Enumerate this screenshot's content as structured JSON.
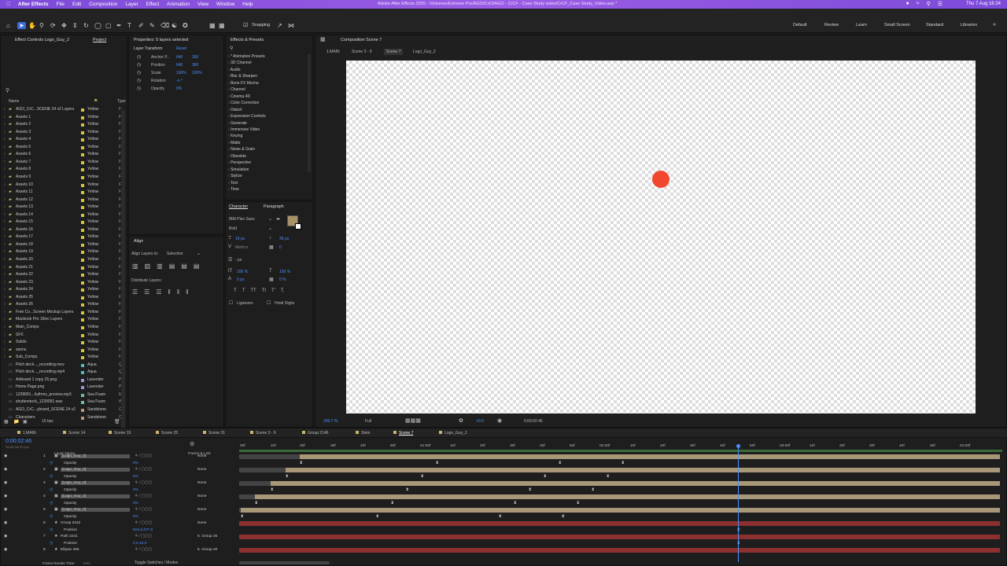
{
  "menubar": {
    "app": "After Effects",
    "items": [
      "File",
      "Edit",
      "Composition",
      "Layer",
      "Effect",
      "Animation",
      "View",
      "Window",
      "Help"
    ],
    "title": "Adobe After Effects 2025 - /Volumes/Extreme Pro/AGO/CrCf/AGO - CrCF - Case Study video/CrCF_Case Study_Video.aep *",
    "clock": "Thu 7 Aug  16:24"
  },
  "toolbar": {
    "snapping": "Snapping",
    "workspaces": [
      "Default",
      "Review",
      "Learn",
      "Small Screen",
      "Standard",
      "Libraries"
    ]
  },
  "effect_controls": {
    "tab": "Effect Controls Logo_Guy_2",
    "project_tab": "Project"
  },
  "properties": {
    "title": "Properties: 5 layers selected",
    "section": "Layer Transform",
    "reset": "Reset",
    "rows": [
      {
        "label": "Anchor P...",
        "v1": "640",
        "v2": "360"
      },
      {
        "label": "Position",
        "v1": "640",
        "v2": "360"
      },
      {
        "label": "Scale",
        "v1": "100%",
        "v2": "100%"
      },
      {
        "label": "Rotation",
        "v1": "-x-°",
        "v2": ""
      },
      {
        "label": "Opacity",
        "v1": "0%",
        "v2": ""
      }
    ]
  },
  "project": {
    "headers": [
      "Name",
      "Type"
    ],
    "items": [
      {
        "name": "AGO_CrC...SCENE 24 v2 Layers",
        "label": "Yellow",
        "type": "F",
        "folder": true
      },
      {
        "name": "Assets 1",
        "label": "Yellow",
        "type": "F",
        "folder": true
      },
      {
        "name": "Assets 2",
        "label": "Yellow",
        "type": "F",
        "folder": true
      },
      {
        "name": "Assets 3",
        "label": "Yellow",
        "type": "F",
        "folder": true
      },
      {
        "name": "Assets 4",
        "label": "Yellow",
        "type": "F",
        "folder": true
      },
      {
        "name": "Assets 5",
        "label": "Yellow",
        "type": "F",
        "folder": true
      },
      {
        "name": "Assets 6",
        "label": "Yellow",
        "type": "F",
        "folder": true
      },
      {
        "name": "Assets 7",
        "label": "Yellow",
        "type": "F",
        "folder": true
      },
      {
        "name": "Assets 8",
        "label": "Yellow",
        "type": "F",
        "folder": true
      },
      {
        "name": "Assets 9",
        "label": "Yellow",
        "type": "F",
        "folder": true
      },
      {
        "name": "Assets 10",
        "label": "Yellow",
        "type": "F",
        "folder": true
      },
      {
        "name": "Assets 11",
        "label": "Yellow",
        "type": "F",
        "folder": true
      },
      {
        "name": "Assets 12",
        "label": "Yellow",
        "type": "F",
        "folder": true
      },
      {
        "name": "Assets 13",
        "label": "Yellow",
        "type": "F",
        "folder": true
      },
      {
        "name": "Assets 14",
        "label": "Yellow",
        "type": "F",
        "folder": true
      },
      {
        "name": "Assets 15",
        "label": "Yellow",
        "type": "F",
        "folder": true
      },
      {
        "name": "Assets 16",
        "label": "Yellow",
        "type": "F",
        "folder": true
      },
      {
        "name": "Assets 17",
        "label": "Yellow",
        "type": "F",
        "folder": true
      },
      {
        "name": "Assets 18",
        "label": "Yellow",
        "type": "F",
        "folder": true
      },
      {
        "name": "Assets 19",
        "label": "Yellow",
        "type": "F",
        "folder": true
      },
      {
        "name": "Assets 20",
        "label": "Yellow",
        "type": "F",
        "folder": true
      },
      {
        "name": "Assets 21",
        "label": "Yellow",
        "type": "F",
        "folder": true
      },
      {
        "name": "Assets 22",
        "label": "Yellow",
        "type": "F",
        "folder": true
      },
      {
        "name": "Assets 23",
        "label": "Yellow",
        "type": "F",
        "folder": true
      },
      {
        "name": "Assets 24",
        "label": "Yellow",
        "type": "F",
        "folder": true
      },
      {
        "name": "Assets 25",
        "label": "Yellow",
        "type": "F",
        "folder": true
      },
      {
        "name": "Assets 26",
        "label": "Yellow",
        "type": "F",
        "folder": true
      },
      {
        "name": "Free Co...Screen Mockup Layers",
        "label": "Yellow",
        "type": "F",
        "folder": true
      },
      {
        "name": "Macbook Pro 16inc Layers",
        "label": "Yellow",
        "type": "F",
        "folder": true
      },
      {
        "name": "Main_Comps",
        "label": "Yellow",
        "type": "F",
        "folder": true
      },
      {
        "name": "SFX",
        "label": "Yellow",
        "type": "F",
        "folder": true
      },
      {
        "name": "Solids",
        "label": "Yellow",
        "type": "F",
        "folder": true
      },
      {
        "name": "stems",
        "label": "Yellow",
        "type": "F",
        "folder": true
      },
      {
        "name": "Sub_Comps",
        "label": "Yellow",
        "type": "F",
        "folder": true
      },
      {
        "name": "Pitch deck..._recording.mov",
        "label": "Aqua",
        "type": "Q",
        "folder": false
      },
      {
        "name": "Pitch deck..._recording.mp4",
        "label": "Aqua",
        "type": "Q",
        "folder": false
      },
      {
        "name": "Artboard 1 copy 25.png",
        "label": "Lavender",
        "type": "P",
        "folder": false
      },
      {
        "name": "Home Page.png",
        "label": "Lavender",
        "type": "P",
        "folder": false
      },
      {
        "name": "1228091...hythms_preview.mp3",
        "label": "Sea Foam",
        "type": "M",
        "folder": false
      },
      {
        "name": "shutterstock_1228091.wav",
        "label": "Sea Foam",
        "type": "W",
        "folder": false
      },
      {
        "name": "AGO_CrC...yboard_SCENE 24 v2",
        "label": "Sandstone",
        "type": "C",
        "folder": false
      },
      {
        "name": "Characters",
        "label": "Sandstone",
        "type": "C",
        "folder": false
      }
    ],
    "bpc": "16 bpc"
  },
  "align": {
    "title": "Align",
    "align_to": "Align Layers to:",
    "selection": "Selection",
    "distribute": "Distribute Layers:"
  },
  "effects": {
    "title": "Effects & Presets",
    "items": [
      "* Animation Presets",
      "3D Channel",
      "Audio",
      "Blur & Sharpen",
      "Boris FX Mocha",
      "Channel",
      "Cinema 4D",
      "Color Correction",
      "Distort",
      "Expression Controls",
      "Generate",
      "Immersive Video",
      "Keying",
      "Matte",
      "Noise & Grain",
      "Obsolete",
      "Perspective",
      "Simulation",
      "Stylize",
      "Text",
      "Time"
    ]
  },
  "character": {
    "tabs": [
      "Character",
      "Paragraph"
    ],
    "font": "IBM Plex Sans",
    "style": "Bold",
    "size": "19 px",
    "leading": "36 px",
    "kerning": "Metrics",
    "tracking": "0",
    "stroke": "- px",
    "vscale": "100 %",
    "hscale": "100 %",
    "baseline": "0 px",
    "tsume": "0 %",
    "ligatures": "Ligatures",
    "hindi": "Hindi Digits"
  },
  "composition": {
    "tab": "Composition Scene 7",
    "breadcrumbs": [
      "1.MAIN",
      "Scene 3 - 9",
      "Scene 7",
      "Logo_Guy_2"
    ],
    "zoom": "249.7 %",
    "quality": "Full",
    "timecode": "0:00:02:46",
    "exposure": "+0.0"
  },
  "timeline_tabs": [
    "1.MAIN",
    "Scene 14",
    "Scene 19",
    "Scene 25",
    "Scene 31",
    "Scene 3 - 9",
    "Group 2146",
    "Stein",
    "Scene 7",
    "Logo_Guy_2"
  ],
  "timeline": {
    "timecode": "0:00:02:46",
    "timecode_sub": "00166 (60.00 fps)",
    "headers": {
      "layer": "Layer Name",
      "parent": "Parent & Link"
    },
    "ruler": [
      "00f",
      "10f",
      "20f",
      "30f",
      "40f",
      "50f",
      "01:00f",
      "10f",
      "20f",
      "30f",
      "40f",
      "50f",
      "02:00f",
      "10f",
      "20f",
      "30f",
      "40f",
      "50f",
      "03:00f",
      "10f",
      "20f",
      "30f",
      "40f",
      "50f",
      "04:00f"
    ],
    "rows": [
      {
        "num": "1",
        "name": "[Logo_Guy_2]",
        "parent": "None",
        "kind": "layer"
      },
      {
        "num": "",
        "name": "Opacity",
        "value": "0%",
        "kind": "prop"
      },
      {
        "num": "2",
        "name": "[Logo_Guy_2]",
        "parent": "None",
        "kind": "layer"
      },
      {
        "num": "",
        "name": "Opacity",
        "value": "0%",
        "kind": "prop"
      },
      {
        "num": "3",
        "name": "[Logo_Guy_2]",
        "parent": "None",
        "kind": "layer"
      },
      {
        "num": "",
        "name": "Opacity",
        "value": "0%",
        "kind": "prop"
      },
      {
        "num": "4",
        "name": "[Logo_Guy_2]",
        "parent": "None",
        "kind": "layer"
      },
      {
        "num": "",
        "name": "Opacity",
        "value": "0%",
        "kind": "prop"
      },
      {
        "num": "5",
        "name": "[Logo_Guy_2]",
        "parent": "None",
        "kind": "layer"
      },
      {
        "num": "",
        "name": "Opacity",
        "value": "0%",
        "kind": "prop"
      },
      {
        "num": "6",
        "name": "Group 2042",
        "parent": "None",
        "kind": "shape"
      },
      {
        "num": "",
        "name": "Position",
        "value": "616.6,277.5",
        "kind": "prop"
      },
      {
        "num": "7",
        "name": "Path 2241",
        "parent": "6. Group 20",
        "kind": "shape"
      },
      {
        "num": "",
        "name": "Position",
        "value": "0.0,15.0",
        "kind": "prop"
      },
      {
        "num": "8",
        "name": "Ellipse 256",
        "parent": "6. Group 20",
        "kind": "shape"
      }
    ],
    "footer": {
      "render_time": "Frame Render Time:",
      "render_value": "0ms",
      "toggle": "Toggle Switches / Modes"
    }
  },
  "colors": {
    "menubar": "#8b53e0",
    "accent": "#4a90ff",
    "dot": "#f2472f",
    "layer_bar": "#a89878",
    "shape_bar": "#8c3030",
    "work_area": "#3a8a3a"
  }
}
